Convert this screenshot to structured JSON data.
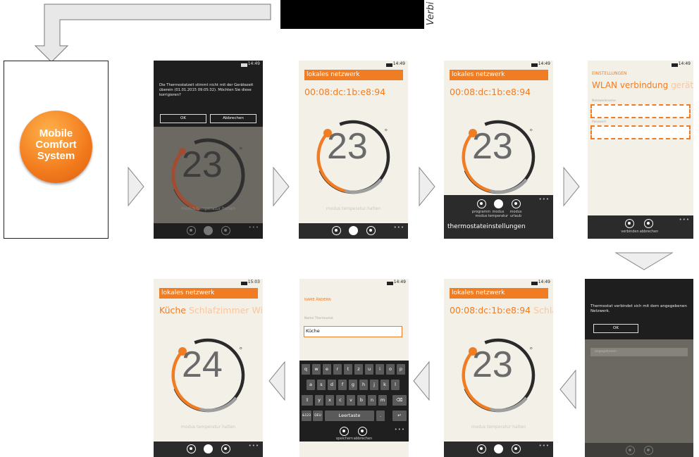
{
  "intro": {
    "logo_lines": [
      "Mobile",
      "Comfort",
      "System"
    ],
    "verbi_text": "Verbi"
  },
  "clock_common": {
    "time": "14:49",
    "time_alt": "15:03"
  },
  "screen1": {
    "dialog_text": "Die Thermostatzeit stimmt nicht mit der Gerätezeit überein (01.01.2015 09:05:32). Möchten Sie diese korrigieren?",
    "ok_label": "OK",
    "cancel_label": "Abbrechen",
    "temperature": "23",
    "mode_hint": "modus temperatur halten"
  },
  "screen2": {
    "header": "lokales netzwerk",
    "mac": "00:08:dc:1b:e8:94",
    "temperature": "23",
    "mode_hint": "modus temperatur halten"
  },
  "screen3": {
    "header": "lokales netzwerk",
    "mac": "00:08:dc:1b:e8:94",
    "temperature": "23",
    "menu_labels": [
      "programm modus",
      "modus temperatur",
      "modus urlaub"
    ],
    "settings_label": "thermostateinstellungen"
  },
  "screen4": {
    "settings_title": "EINSTELLUNGEN",
    "tab_active": "WLAN verbindung",
    "tab_inactive": "geräte",
    "field1_label": "Netzwerkname",
    "field2_label": "Passwort",
    "btn_connect": "verbinden",
    "btn_cancel": "abbrechen"
  },
  "screen5": {
    "message": "Thermostat verbindet sich mit dem angegebenen Netzwerk.",
    "ok_label": "OK",
    "network_item": "angegebenen"
  },
  "screen6": {
    "header": "lokales netzwerk",
    "mac": "00:08:dc:1b:e8:94",
    "mac_next": "Schlafz",
    "temperature": "23",
    "mode_hint": "modus temperatur halten"
  },
  "screen7": {
    "title": "NAME ÄNDERN",
    "field_label": "Name Thermostat",
    "input_value": "Küche",
    "keyboard_row1": [
      "q",
      "w",
      "e",
      "r",
      "t",
      "z",
      "u",
      "i",
      "o",
      "p"
    ],
    "keyboard_row2": [
      "a",
      "s",
      "d",
      "f",
      "g",
      "h",
      "j",
      "k",
      "l"
    ],
    "keyboard_row3": [
      "y",
      "x",
      "c",
      "v",
      "b",
      "n",
      "m"
    ],
    "key_shift": "⇧",
    "key_back": "⌫",
    "key_num": "&123",
    "key_lang": "DEU",
    "key_space": "Leertaste",
    "key_dot": ".",
    "key_enter": "↵",
    "btn_save": "speichern",
    "btn_cancel": "abbrechen"
  },
  "screen8": {
    "header": "lokales netzwerk",
    "tab_active": "Küche",
    "tab_second": "Schlafzimmer",
    "tab_third": "Win",
    "temperature": "24",
    "mode_hint": "modus temperatur halten"
  },
  "colors": {
    "accent": "#f07d24",
    "screen_bg": "#f3f0e8",
    "appbar": "#2b2b2b"
  }
}
